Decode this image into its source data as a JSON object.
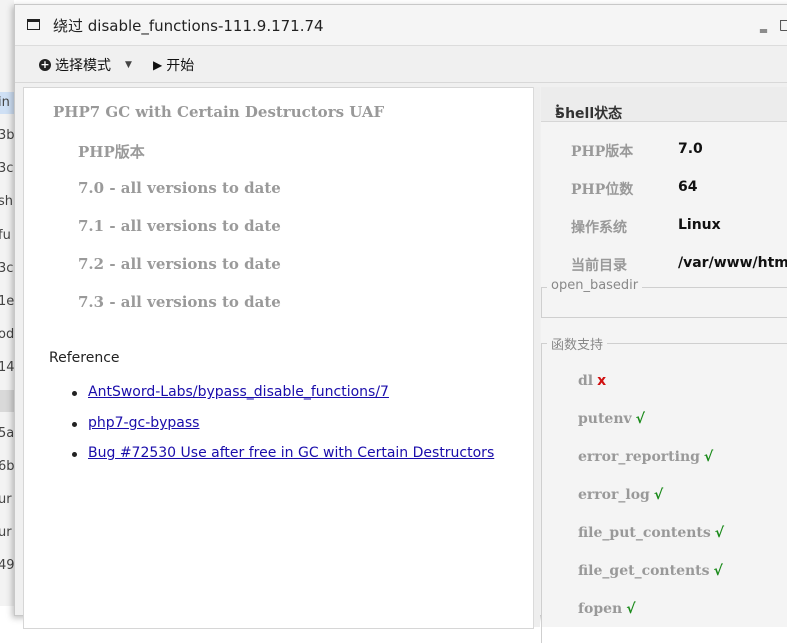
{
  "background": {
    "rows": [
      {
        "text": "in",
        "state": "selected"
      },
      {
        "text": "3b",
        "state": ""
      },
      {
        "text": "3c",
        "state": ""
      },
      {
        "text": "sh",
        "state": ""
      },
      {
        "text": "fu",
        "state": ""
      },
      {
        "text": "3c",
        "state": ""
      },
      {
        "text": "1e",
        "state": ""
      },
      {
        "text": "od",
        "state": ""
      },
      {
        "text": "14",
        "state": ""
      },
      {
        "text": "",
        "state": "gray"
      },
      {
        "text": "5a",
        "state": ""
      },
      {
        "text": "6b",
        "state": ""
      },
      {
        "text": "ur",
        "state": ""
      },
      {
        "text": "ur",
        "state": ""
      },
      {
        "text": "49",
        "state": ""
      }
    ]
  },
  "window": {
    "title": "绕过 disable_functions-111.9.171.74",
    "icon": "window-icon",
    "controls": {
      "minimize": "‗",
      "maximize": "□"
    }
  },
  "toolbar": {
    "mode_label": "选择模式",
    "mode_icon": "plus-circle-icon",
    "start_label": "开始",
    "start_icon": "play-icon"
  },
  "exploit": {
    "title": "PHP7 GC with Certain Destructors UAF",
    "version_header": "PHP版本",
    "versions": [
      "7.0 - all versions to date",
      "7.1 - all versions to date",
      "7.2 - all versions to date",
      "7.3 - all versions to date"
    ],
    "reference_label": "Reference",
    "references": [
      "AntSword-Labs/bypass_disable_functions/7",
      "php7-gc-bypass",
      "Bug #72530 Use after free in GC with Certain Destructors"
    ]
  },
  "shell": {
    "header": "Shell状态",
    "header_icon": "info-icon",
    "info": [
      {
        "key": "PHP版本",
        "value": "7.0"
      },
      {
        "key": "PHP位数",
        "value": "64"
      },
      {
        "key": "操作系统",
        "value": "Linux"
      },
      {
        "key": "当前目录",
        "value": "/var/www/html"
      }
    ],
    "open_basedir_label": "open_basedir",
    "functions_label": "函数支持",
    "functions": [
      {
        "name": "dl",
        "mark": "x",
        "supported": false
      },
      {
        "name": "putenv",
        "mark": "√",
        "supported": true
      },
      {
        "name": "error_reporting",
        "mark": "√",
        "supported": true
      },
      {
        "name": "error_log",
        "mark": "√",
        "supported": true
      },
      {
        "name": "file_put_contents",
        "mark": "√",
        "supported": true
      },
      {
        "name": "file_get_contents",
        "mark": "√",
        "supported": true
      },
      {
        "name": "fopen",
        "mark": "√",
        "supported": true
      }
    ],
    "colors": {
      "ok": "#1a8a1a",
      "no": "#d01010"
    }
  }
}
